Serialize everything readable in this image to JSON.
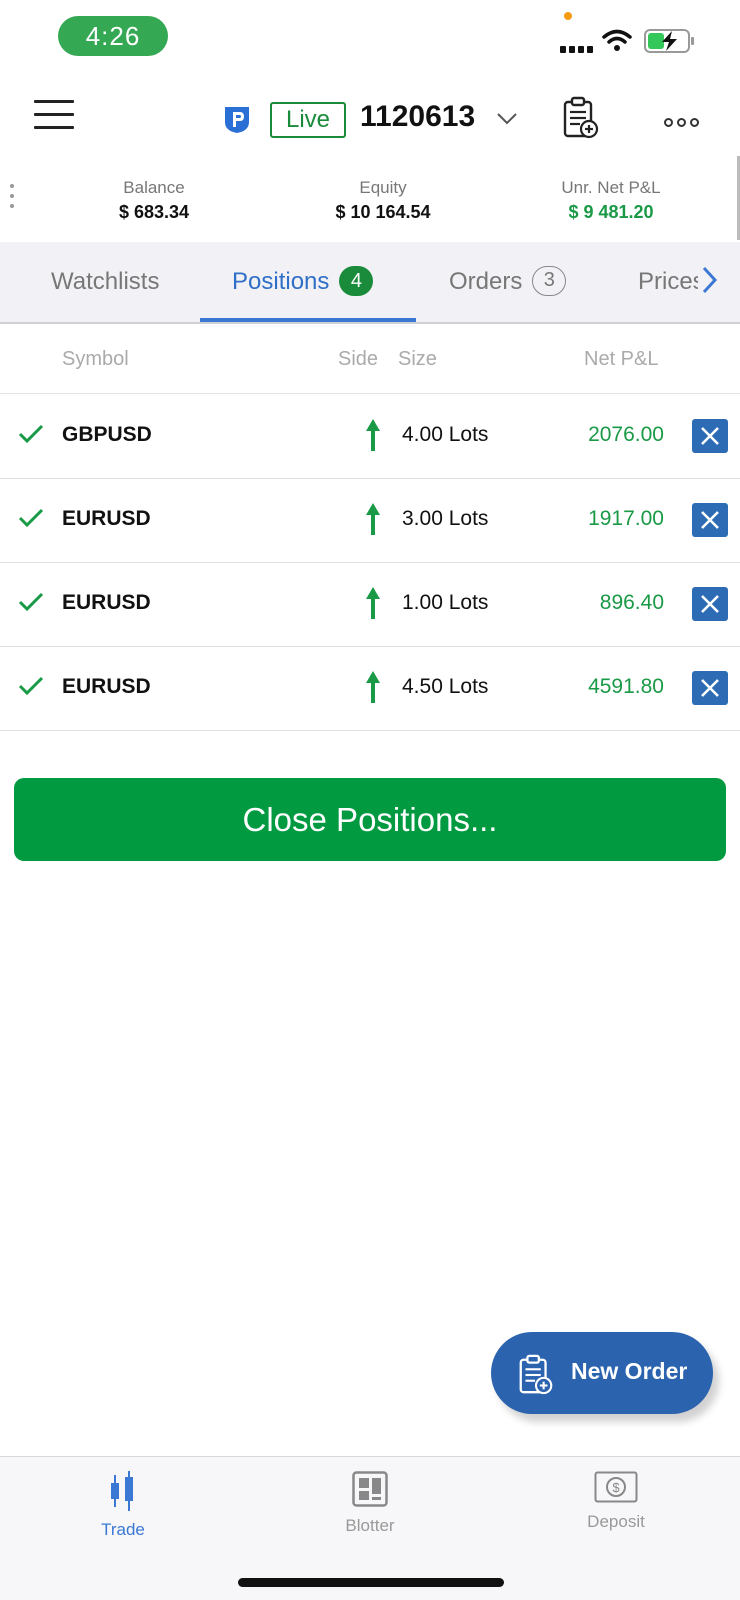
{
  "status_bar": {
    "time": "4:26",
    "time_pill_color": "#34a853"
  },
  "header": {
    "live_label": "Live",
    "account_number": "1120613"
  },
  "summary": {
    "balance_label": "Balance",
    "balance_value": "$ 683.34",
    "equity_label": "Equity",
    "equity_value": "$ 10 164.54",
    "pnl_label": "Unr. Net P&L",
    "pnl_value": "$ 9 481.20"
  },
  "tabs": {
    "watchlists": "Watchlists",
    "positions": "Positions",
    "positions_count": "4",
    "orders": "Orders",
    "orders_count": "3",
    "price": "Prices",
    "active": "positions"
  },
  "table": {
    "headers": {
      "symbol": "Symbol",
      "side": "Side",
      "size": "Size",
      "pnl": "Net P&L"
    },
    "rows": [
      {
        "symbol": "GBPUSD",
        "side": "buy",
        "size": "4.00 Lots",
        "pnl": "2076.00"
      },
      {
        "symbol": "EURUSD",
        "side": "buy",
        "size": "3.00 Lots",
        "pnl": "1917.00"
      },
      {
        "symbol": "EURUSD",
        "side": "buy",
        "size": "1.00 Lots",
        "pnl": "896.40"
      },
      {
        "symbol": "EURUSD",
        "side": "buy",
        "size": "4.50 Lots",
        "pnl": "4591.80"
      }
    ]
  },
  "close_positions_label": "Close Positions...",
  "new_order_label": "New Order",
  "bottom_nav": {
    "trade": "Trade",
    "blotter": "Blotter",
    "deposit": "Deposit",
    "active": "trade"
  },
  "colors": {
    "accent_blue": "#3a78d4",
    "positive_green": "#1a9a46",
    "close_button_green": "#029a40",
    "close_x_blue": "#2d6bb5"
  },
  "icons": {
    "row_check": "check-icon",
    "row_side": "arrow-up-icon",
    "row_close": "close-icon"
  }
}
